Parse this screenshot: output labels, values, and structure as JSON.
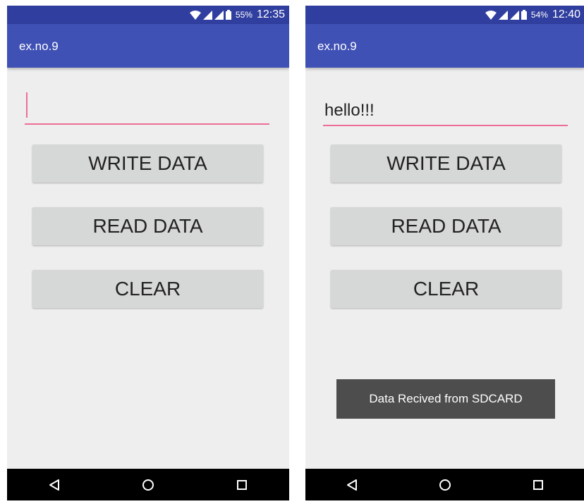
{
  "screens": [
    {
      "status": {
        "battery": "55%",
        "time": "12:35"
      },
      "app_title": "ex.no.9",
      "input_value": "",
      "buttons": {
        "write": "WRITE DATA",
        "read": "READ DATA",
        "clear": "CLEAR"
      },
      "toast": ""
    },
    {
      "status": {
        "battery": "54%",
        "time": "12:40"
      },
      "app_title": "ex.no.9",
      "input_value": "hello!!!",
      "buttons": {
        "write": "WRITE DATA",
        "read": "READ DATA",
        "clear": "CLEAR"
      },
      "toast": "Data Recived from SDCARD"
    }
  ],
  "icons": {
    "status": [
      "wifi-icon",
      "signal-icon",
      "signal-icon",
      "battery-icon"
    ],
    "nav": [
      "back-icon",
      "home-icon",
      "recents-icon"
    ]
  },
  "colors": {
    "status_bar": "#303f9f",
    "app_bar": "#3f51b5",
    "accent": "#ec6e96",
    "button": "#d6d7d7",
    "background": "#eeeeee",
    "toast": "#4d4d4d",
    "nav_bar": "#000000"
  }
}
